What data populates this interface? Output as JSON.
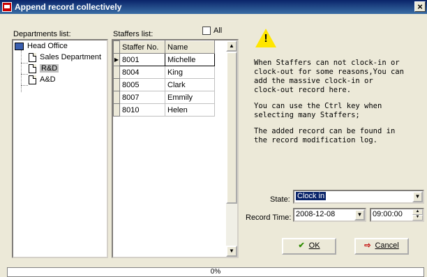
{
  "window": {
    "title": "Append record collectively",
    "close": "×"
  },
  "departments": {
    "label": "Departments list:",
    "root": "Head Office",
    "children": [
      "Sales Department",
      "R&D",
      "A&D"
    ],
    "selected": "R&D"
  },
  "staffers": {
    "label": "Staffers list:",
    "all_label": "All",
    "columns": [
      "Staffer No.",
      "Name"
    ],
    "rows": [
      {
        "no": "8001",
        "name": "Michelle"
      },
      {
        "no": "8004",
        "name": "King"
      },
      {
        "no": "8005",
        "name": "Clark"
      },
      {
        "no": "8007",
        "name": "Emmily"
      },
      {
        "no": "8010",
        "name": "Helen"
      }
    ]
  },
  "info": {
    "warning_mark": "!",
    "message1": "When Staffers can not clock-in or\nclock-out for some reasons,You can\nadd the massive clock-in or\nclock-out record here.",
    "message2": "You can use the Ctrl key when\nselecting many Staffers;",
    "message3": "The added record can be found in\nthe record modification log."
  },
  "form": {
    "state_label": "State:",
    "state_value": "Clock in",
    "record_time_label": "Record Time:",
    "date_value": "2008-12-08",
    "time_value": "09:00:00"
  },
  "buttons": {
    "ok": "OK",
    "cancel": "Cancel"
  },
  "progress": {
    "text": "0%",
    "value": 0
  },
  "colors": {
    "title_bar": "#0a246a",
    "selection": "#0a246a",
    "warning": "#ffe600",
    "ok_check": "#2e8b00",
    "cancel_icon": "#c00000"
  }
}
